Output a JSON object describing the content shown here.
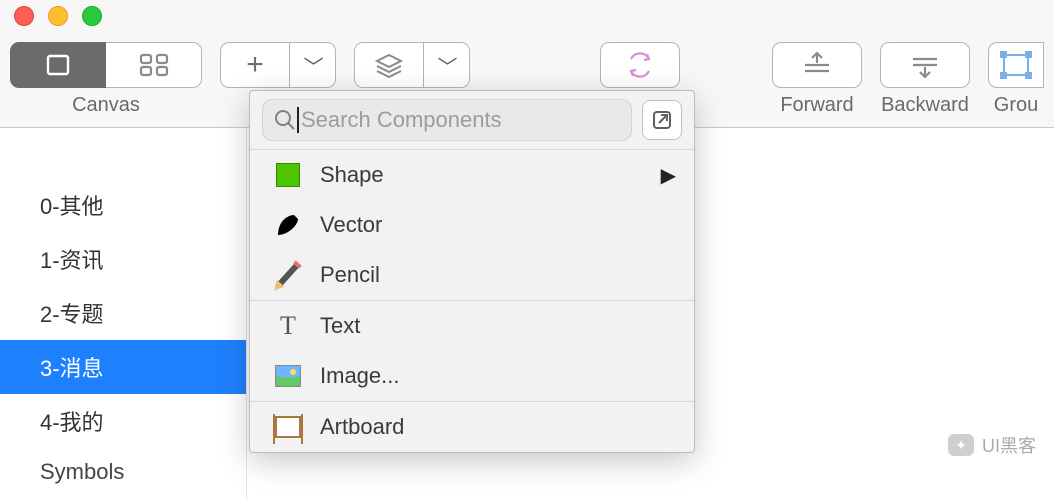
{
  "toolbar": {
    "canvas_label": "Canvas",
    "forward_label": "Forward",
    "backward_label": "Backward",
    "group_label": "Grou"
  },
  "sidebar": {
    "items": [
      {
        "label": "0-其他",
        "selected": false
      },
      {
        "label": "1-资讯",
        "selected": false
      },
      {
        "label": "2-专题",
        "selected": false
      },
      {
        "label": "3-消息",
        "selected": true
      },
      {
        "label": "4-我的",
        "selected": false
      },
      {
        "label": "Symbols",
        "selected": false
      }
    ]
  },
  "popover": {
    "search_placeholder": "Search Components",
    "items": [
      {
        "label": "Shape",
        "icon": "shape",
        "has_submenu": true
      },
      {
        "label": "Vector",
        "icon": "vector",
        "has_submenu": false
      },
      {
        "label": "Pencil",
        "icon": "pencil",
        "has_submenu": false
      },
      {
        "label": "Text",
        "icon": "text",
        "has_submenu": false
      },
      {
        "label": "Image...",
        "icon": "image",
        "has_submenu": false
      },
      {
        "label": "Artboard",
        "icon": "artboard",
        "has_submenu": false
      }
    ]
  },
  "watermark": {
    "text": "UI黑客"
  }
}
